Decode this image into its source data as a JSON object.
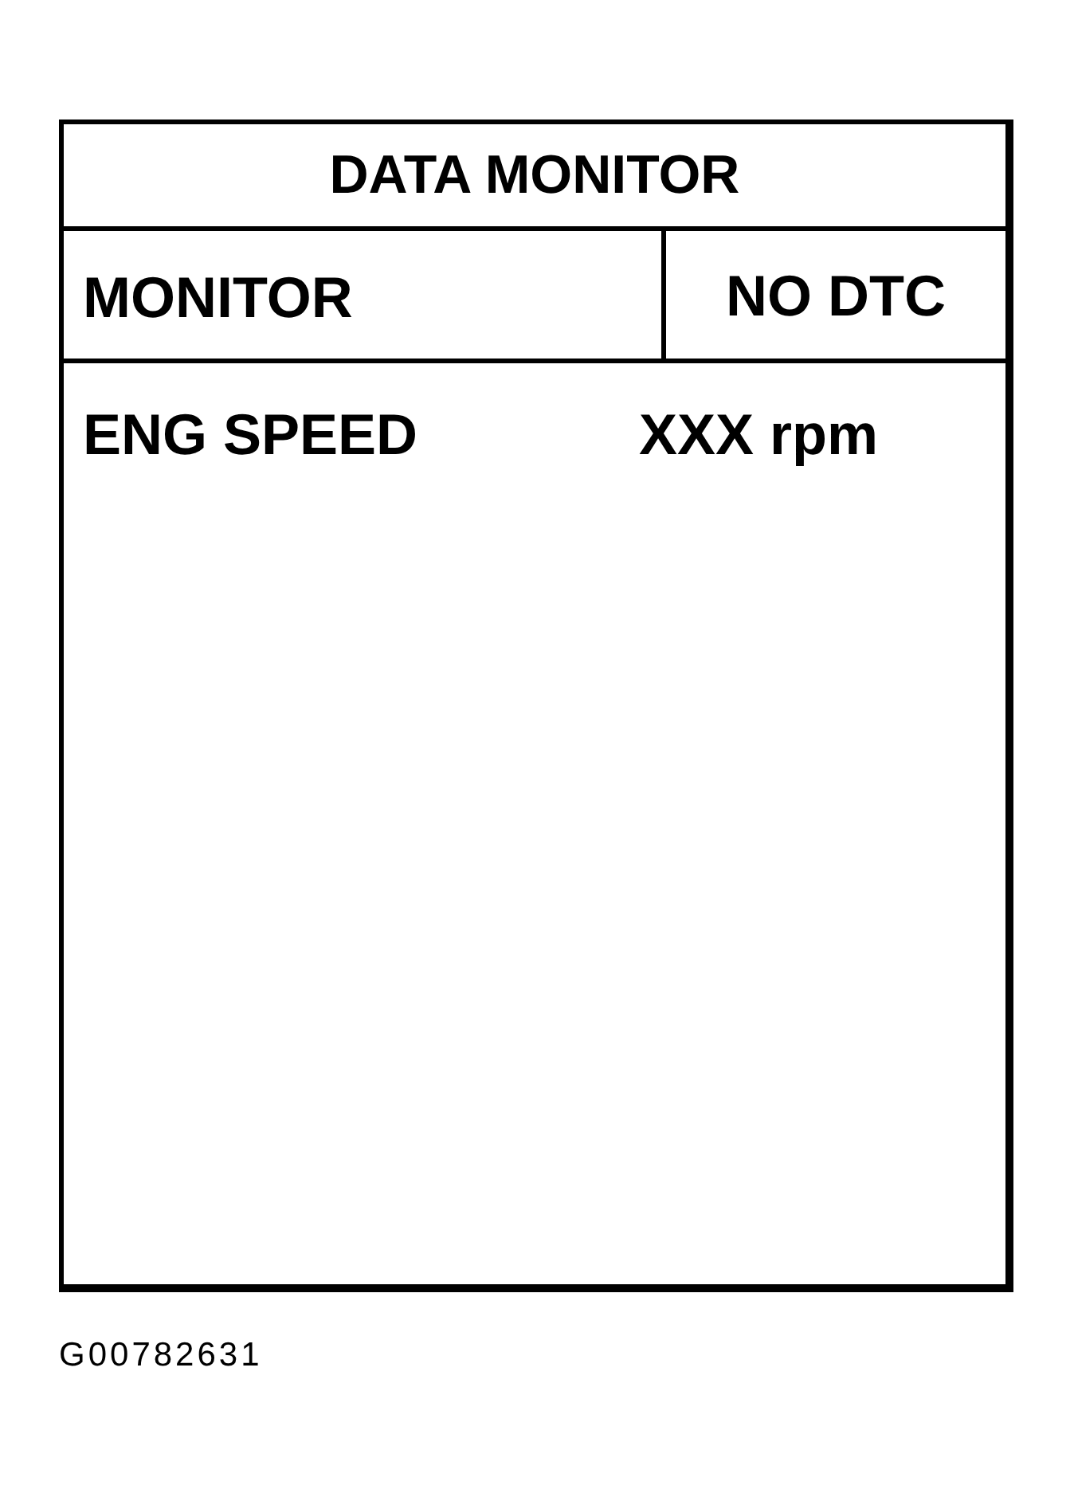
{
  "panel": {
    "title": "DATA MONITOR",
    "header": {
      "label": "MONITOR",
      "status": "NO DTC"
    },
    "rows": [
      {
        "name": "ENG SPEED",
        "value": "XXX rpm"
      }
    ]
  },
  "figure_id": "G00782631"
}
